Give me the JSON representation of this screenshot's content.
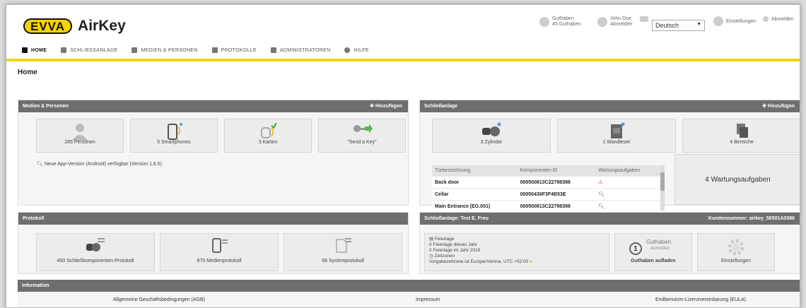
{
  "app": {
    "brand": "EVVA",
    "title": "AirKey"
  },
  "topright": {
    "credit_title": "Guthaben",
    "credit_sub": "45 Guthaben",
    "user_title": "John Doe",
    "user_sub": "Abmelden",
    "language": "Deutsch",
    "settings": "Einstellungen",
    "logout": "Abmelden"
  },
  "nav": [
    {
      "label": "HOME"
    },
    {
      "label": "SCHLIESSANLAGE"
    },
    {
      "label": "MEDIEN & PERSONEN"
    },
    {
      "label": "PROTOKOLLE"
    },
    {
      "label": "ADMINISTRATOREN"
    },
    {
      "label": "HILFE"
    }
  ],
  "page_title": "Home",
  "media": {
    "header": "Medien & Personen",
    "add": "Hinzufügen",
    "tiles": [
      {
        "label": "285 Personen",
        "icon": "person-icon"
      },
      {
        "label": "5 Smartphones",
        "icon": "smartphone-icon"
      },
      {
        "label": "3 Karten",
        "icon": "card-icon"
      },
      {
        "label": "\"Send a Key\"",
        "icon": "send-key-icon"
      }
    ],
    "note": "Neue App-Version (Android) verfügbar (Version 1.6.5)"
  },
  "locking": {
    "header": "Schließanlage",
    "add": "Hinzufügen",
    "tiles": [
      {
        "label": "3 Zylinder",
        "icon": "cylinder-icon"
      },
      {
        "label": "1 Wandleser",
        "icon": "wall-reader-icon"
      },
      {
        "label": "4 Bereiche",
        "icon": "areas-icon"
      }
    ],
    "table": {
      "headers": [
        "Türbezeichnung",
        "Komponenten-ID",
        "Wartungsaufgaben"
      ],
      "rows": [
        {
          "door": "Back door",
          "id": "000500813C22798398"
        },
        {
          "door": "Cellar",
          "id": "00050436F3F4B53E"
        },
        {
          "door": "Main Entrance (EG.001)",
          "id": "000500813C22798398"
        }
      ]
    },
    "maintenance": "4 Wartungsaufgaben"
  },
  "protocol": {
    "header": "Protokoll",
    "tiles": [
      {
        "label": "450 Schließkomponenten-Protokoll",
        "icon": "cylinder-log-icon"
      },
      {
        "label": "875 Medienprotokoll",
        "icon": "phone-log-icon"
      },
      {
        "label": "56 Systemprotokoll",
        "icon": "system-log-icon"
      }
    ]
  },
  "locksystem": {
    "header": "Schließanlage: Test E. Freu",
    "customer": "Kundennummer: airkey_56501A0086",
    "holidays_title": "Feiertage",
    "holidays_line1": "0 Feiertage dieses Jahr",
    "holidays_line2": "0 Feiertage im Jahr 2019",
    "timezone_title": "Zeitzonen",
    "timezone_line": "Vorgabezeitzone ist Europe/Vienna, UTC +02:00",
    "credit_title": "Guthaben",
    "credit_sub": "Anmelden",
    "credit_count": "1",
    "credit_action": "Guthaben aufladen",
    "settings_label": "Einstellungen"
  },
  "info": {
    "header": "Information",
    "links": [
      "Allgemeine Geschäftsbedingungen (AGB)",
      "Impressum",
      "Endbenutzer-Lizenzvereinbarung (EULA)"
    ]
  }
}
